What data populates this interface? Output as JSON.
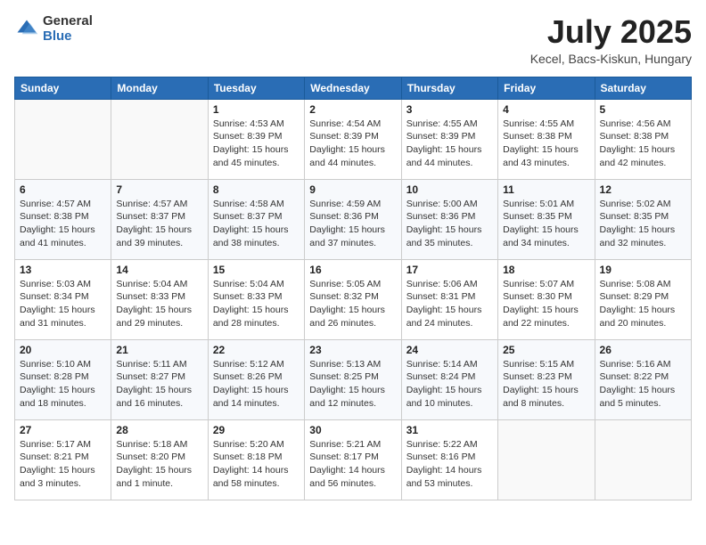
{
  "header": {
    "logo_general": "General",
    "logo_blue": "Blue",
    "month_title": "July 2025",
    "location": "Kecel, Bacs-Kiskun, Hungary"
  },
  "weekdays": [
    "Sunday",
    "Monday",
    "Tuesday",
    "Wednesday",
    "Thursday",
    "Friday",
    "Saturday"
  ],
  "weeks": [
    [
      {
        "day": "",
        "info": ""
      },
      {
        "day": "",
        "info": ""
      },
      {
        "day": "1",
        "info": "Sunrise: 4:53 AM\nSunset: 8:39 PM\nDaylight: 15 hours and 45 minutes."
      },
      {
        "day": "2",
        "info": "Sunrise: 4:54 AM\nSunset: 8:39 PM\nDaylight: 15 hours and 44 minutes."
      },
      {
        "day": "3",
        "info": "Sunrise: 4:55 AM\nSunset: 8:39 PM\nDaylight: 15 hours and 44 minutes."
      },
      {
        "day": "4",
        "info": "Sunrise: 4:55 AM\nSunset: 8:38 PM\nDaylight: 15 hours and 43 minutes."
      },
      {
        "day": "5",
        "info": "Sunrise: 4:56 AM\nSunset: 8:38 PM\nDaylight: 15 hours and 42 minutes."
      }
    ],
    [
      {
        "day": "6",
        "info": "Sunrise: 4:57 AM\nSunset: 8:38 PM\nDaylight: 15 hours and 41 minutes."
      },
      {
        "day": "7",
        "info": "Sunrise: 4:57 AM\nSunset: 8:37 PM\nDaylight: 15 hours and 39 minutes."
      },
      {
        "day": "8",
        "info": "Sunrise: 4:58 AM\nSunset: 8:37 PM\nDaylight: 15 hours and 38 minutes."
      },
      {
        "day": "9",
        "info": "Sunrise: 4:59 AM\nSunset: 8:36 PM\nDaylight: 15 hours and 37 minutes."
      },
      {
        "day": "10",
        "info": "Sunrise: 5:00 AM\nSunset: 8:36 PM\nDaylight: 15 hours and 35 minutes."
      },
      {
        "day": "11",
        "info": "Sunrise: 5:01 AM\nSunset: 8:35 PM\nDaylight: 15 hours and 34 minutes."
      },
      {
        "day": "12",
        "info": "Sunrise: 5:02 AM\nSunset: 8:35 PM\nDaylight: 15 hours and 32 minutes."
      }
    ],
    [
      {
        "day": "13",
        "info": "Sunrise: 5:03 AM\nSunset: 8:34 PM\nDaylight: 15 hours and 31 minutes."
      },
      {
        "day": "14",
        "info": "Sunrise: 5:04 AM\nSunset: 8:33 PM\nDaylight: 15 hours and 29 minutes."
      },
      {
        "day": "15",
        "info": "Sunrise: 5:04 AM\nSunset: 8:33 PM\nDaylight: 15 hours and 28 minutes."
      },
      {
        "day": "16",
        "info": "Sunrise: 5:05 AM\nSunset: 8:32 PM\nDaylight: 15 hours and 26 minutes."
      },
      {
        "day": "17",
        "info": "Sunrise: 5:06 AM\nSunset: 8:31 PM\nDaylight: 15 hours and 24 minutes."
      },
      {
        "day": "18",
        "info": "Sunrise: 5:07 AM\nSunset: 8:30 PM\nDaylight: 15 hours and 22 minutes."
      },
      {
        "day": "19",
        "info": "Sunrise: 5:08 AM\nSunset: 8:29 PM\nDaylight: 15 hours and 20 minutes."
      }
    ],
    [
      {
        "day": "20",
        "info": "Sunrise: 5:10 AM\nSunset: 8:28 PM\nDaylight: 15 hours and 18 minutes."
      },
      {
        "day": "21",
        "info": "Sunrise: 5:11 AM\nSunset: 8:27 PM\nDaylight: 15 hours and 16 minutes."
      },
      {
        "day": "22",
        "info": "Sunrise: 5:12 AM\nSunset: 8:26 PM\nDaylight: 15 hours and 14 minutes."
      },
      {
        "day": "23",
        "info": "Sunrise: 5:13 AM\nSunset: 8:25 PM\nDaylight: 15 hours and 12 minutes."
      },
      {
        "day": "24",
        "info": "Sunrise: 5:14 AM\nSunset: 8:24 PM\nDaylight: 15 hours and 10 minutes."
      },
      {
        "day": "25",
        "info": "Sunrise: 5:15 AM\nSunset: 8:23 PM\nDaylight: 15 hours and 8 minutes."
      },
      {
        "day": "26",
        "info": "Sunrise: 5:16 AM\nSunset: 8:22 PM\nDaylight: 15 hours and 5 minutes."
      }
    ],
    [
      {
        "day": "27",
        "info": "Sunrise: 5:17 AM\nSunset: 8:21 PM\nDaylight: 15 hours and 3 minutes."
      },
      {
        "day": "28",
        "info": "Sunrise: 5:18 AM\nSunset: 8:20 PM\nDaylight: 15 hours and 1 minute."
      },
      {
        "day": "29",
        "info": "Sunrise: 5:20 AM\nSunset: 8:18 PM\nDaylight: 14 hours and 58 minutes."
      },
      {
        "day": "30",
        "info": "Sunrise: 5:21 AM\nSunset: 8:17 PM\nDaylight: 14 hours and 56 minutes."
      },
      {
        "day": "31",
        "info": "Sunrise: 5:22 AM\nSunset: 8:16 PM\nDaylight: 14 hours and 53 minutes."
      },
      {
        "day": "",
        "info": ""
      },
      {
        "day": "",
        "info": ""
      }
    ]
  ]
}
